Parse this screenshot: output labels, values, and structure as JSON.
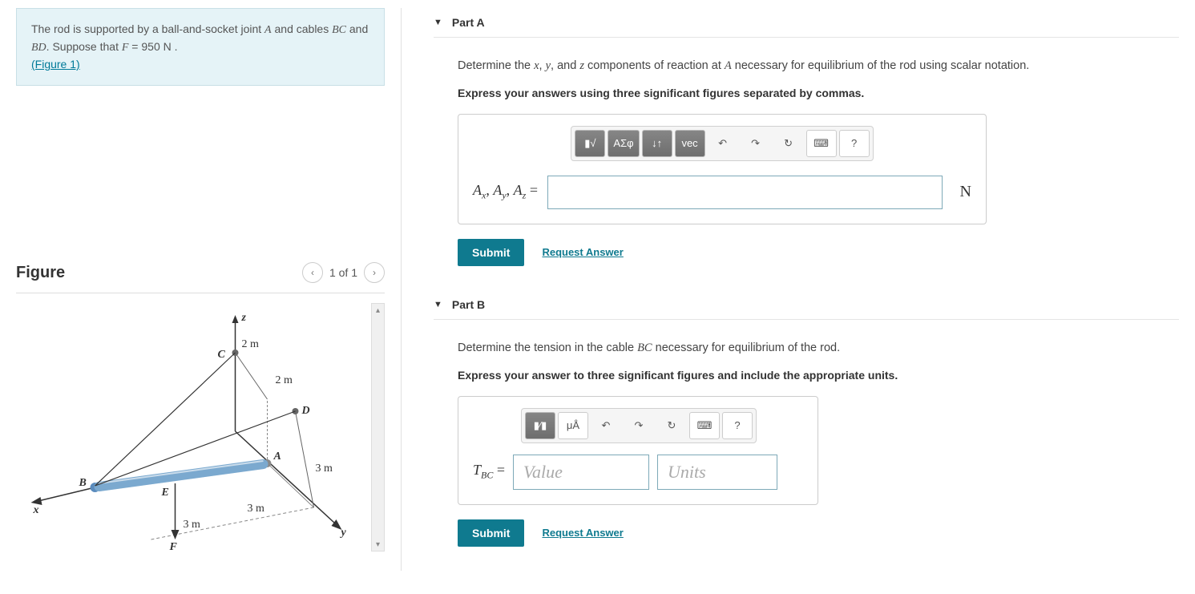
{
  "problem": {
    "text_prefix": "The rod is supported by a ball-and-socket joint ",
    "joint": "A",
    "text_mid": " and cables ",
    "cable1": "BC",
    "text_mid2": " and ",
    "cable2": "BD",
    "text_suppose": ". Suppose that ",
    "F_sym": "F",
    "F_eq": " = 950  N .",
    "figure_link": "(Figure 1)"
  },
  "figure": {
    "title": "Figure",
    "pager": "1 of 1",
    "labels": {
      "z": "z",
      "y": "y",
      "x": "x",
      "A": "A",
      "B": "B",
      "C": "C",
      "D": "D",
      "E": "E",
      "F": "F",
      "d2m_a": "2 m",
      "d2m_b": "2 m",
      "d3m_a": "3 m",
      "d3m_b": "3 m",
      "d3m_c": "3 m"
    }
  },
  "partA": {
    "title": "Part A",
    "prompt_pre": "Determine the ",
    "x": "x",
    "c1": ", ",
    "y": "y",
    "c2": ", and ",
    "z": "z",
    "prompt_mid": " components of reaction at ",
    "A": "A",
    "prompt_post": " necessary for equilibrium of the rod using scalar notation.",
    "instr": "Express your answers using three significant figures separated by commas.",
    "toolbar": {
      "templates": "▮√",
      "greek": "ΑΣφ",
      "sort": "↓↑",
      "vec": "vec",
      "undo": "↶",
      "redo": "↷",
      "refresh": "↻",
      "keyboard": "⌨",
      "help": "?"
    },
    "varlabel_Ax": "A",
    "sub_x": "x",
    "comma": ", ",
    "varlabel_Ay": "A",
    "sub_y": "y",
    "varlabel_Az": "A",
    "sub_z": "z",
    "eq": " = ",
    "unit": "N",
    "submit": "Submit",
    "request": "Request Answer"
  },
  "partB": {
    "title": "Part B",
    "prompt_pre": "Determine the tension in the cable ",
    "BC": "BC",
    "prompt_post": " necessary for equilibrium of the rod.",
    "instr": "Express your answer to three significant figures and include the appropriate units.",
    "toolbar": {
      "templates": "▮⁄▮",
      "units": "μÅ",
      "undo": "↶",
      "redo": "↷",
      "refresh": "↻",
      "keyboard": "⌨",
      "help": "?"
    },
    "varlabel_T": "T",
    "sub_BC": "BC",
    "eq": " = ",
    "value_ph": "Value",
    "units_ph": "Units",
    "submit": "Submit",
    "request": "Request Answer"
  }
}
